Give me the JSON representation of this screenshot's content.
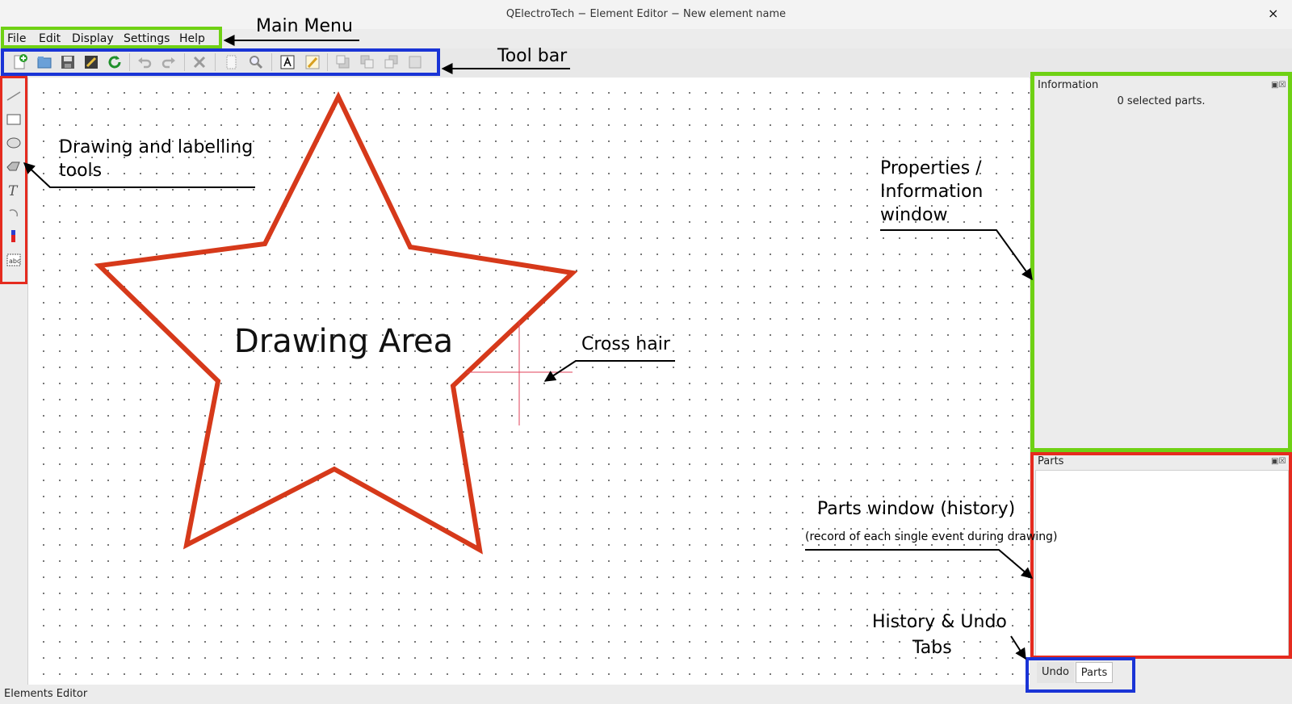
{
  "window": {
    "title": "QElectroTech − Element Editor − New element name",
    "close_glyph": "×"
  },
  "menu": {
    "items": [
      "File",
      "Edit",
      "Display",
      "Settings",
      "Help"
    ]
  },
  "toolbar": {
    "buttons": [
      "new-element-icon",
      "open-icon",
      "save-icon",
      "save-as-icon",
      "reload-icon",
      "undo-icon",
      "redo-icon",
      "delete-icon",
      "select-all-icon",
      "zoom-icon",
      "edit-names-icon",
      "edit-info-icon",
      "bring-front-icon",
      "raise-icon",
      "lower-icon",
      "send-back-icon"
    ]
  },
  "tools": [
    "line-tool-icon",
    "rectangle-tool-icon",
    "ellipse-tool-icon",
    "polygon-tool-icon",
    "text-tool-icon",
    "arc-tool-icon",
    "terminal-tool-icon",
    "text-field-tool-icon"
  ],
  "info_panel": {
    "title": "Information",
    "message": "0 selected parts."
  },
  "parts_panel": {
    "title": "Parts"
  },
  "tabs": {
    "undo": "Undo",
    "parts": "Parts"
  },
  "status": {
    "text": "Elements Editor"
  },
  "annotations": {
    "main_menu": "Main Menu",
    "tool_bar": "Tool bar",
    "drawing_tools": [
      "Drawing and labelling",
      "tools"
    ],
    "properties": [
      "Properties /",
      "Information",
      "window"
    ],
    "drawing_area": "Drawing Area",
    "cross_hair": "Cross hair",
    "parts_window": "Parts window (history)",
    "parts_window_sub": "(record of each single event during drawing)",
    "history_tabs": [
      "History & Undo",
      "Tabs"
    ]
  },
  "colors": {
    "annot_green": "#6fd114",
    "annot_blue": "#1a34d6",
    "annot_red": "#e52b1f",
    "star": "#d6391a",
    "crosshair": "#e0405a"
  }
}
